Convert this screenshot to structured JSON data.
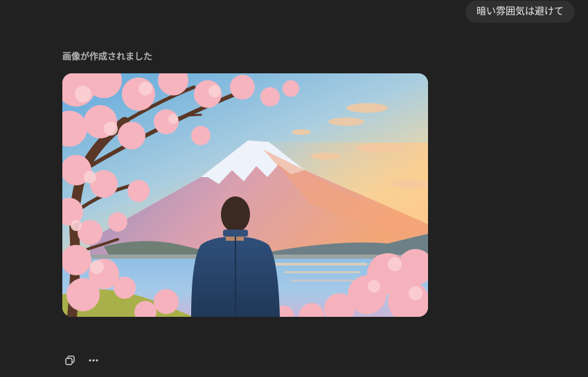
{
  "user_message": {
    "text": "暗い雰囲気は避けて"
  },
  "assistant": {
    "status_label": "画像が作成されました",
    "image": {
      "description_icon": "generated-image"
    },
    "actions": [
      {
        "name": "copy-icon"
      },
      {
        "name": "more-options-icon"
      }
    ]
  },
  "colors": {
    "background": "#212121",
    "bubble": "#303030",
    "label": "#b4b4b4",
    "icon": "#d6d6d6"
  }
}
